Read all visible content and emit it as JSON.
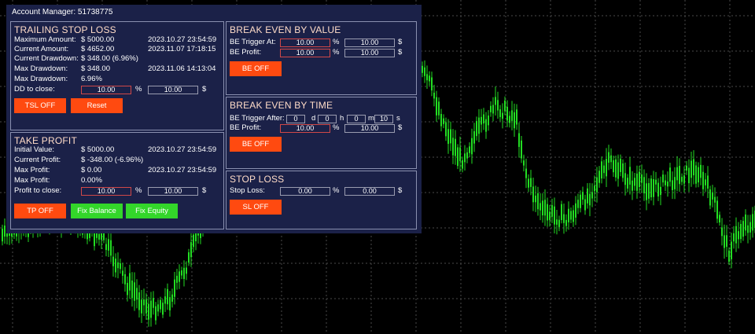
{
  "colors": {
    "panel_bg": "#1b2148",
    "section_border": "#8a90b0",
    "title_color": "#ffdcc8",
    "orange_button": "#ff4a10",
    "green_button": "#33d62a",
    "candle": "#22dd22",
    "grid": "#4a4a4a"
  },
  "panel": {
    "title": "Account Manager: 51738775"
  },
  "trailing_stop_loss": {
    "title": "TRAILING STOP LOSS",
    "rows": [
      {
        "label": "Maximum Amount:",
        "value": "$ 5000.00",
        "time": "2023.10.27 23:54:59"
      },
      {
        "label": "Current Amount:",
        "value": "$ 4652.00",
        "time": "2023.11.07 17:18:15"
      },
      {
        "label": "Current Drawdown:",
        "value": "$ 348.00 (6.96%)",
        "time": ""
      },
      {
        "label": "Max Drawdown:",
        "value": "$ 348.00",
        "time": "2023.11.06 14:13:04"
      },
      {
        "label": "Max Drawdown:",
        "value": "6.96%",
        "time": ""
      }
    ],
    "dd_label": "DD to close:",
    "dd_percent_value": "10.00",
    "percent_unit": "%",
    "dd_dollar_value": "10.00",
    "dollar_unit": "$",
    "tsl_button": "TSL OFF",
    "reset_button": "Reset"
  },
  "take_profit": {
    "title": "TAKE PROFIT",
    "rows": [
      {
        "label": "Initial Value:",
        "value": "$ 5000.00",
        "time": "2023.10.27 23:54:59"
      },
      {
        "label": "Current Profit:",
        "value": "$ -348.00 (-6.96%)",
        "time": ""
      },
      {
        "label": "Max Profit:",
        "value": "$ 0.00",
        "time": "2023.10.27 23:54:59"
      },
      {
        "label": "Max Profit:",
        "value": "0.00%",
        "time": ""
      }
    ],
    "ptc_label": "Profit to close:",
    "ptc_percent_value": "10.00",
    "percent_unit": "%",
    "ptc_dollar_value": "10.00",
    "dollar_unit": "$",
    "tp_button": "TP OFF",
    "fix_balance_button": "Fix Balance",
    "fix_equity_button": "Fix Equity"
  },
  "break_even_value": {
    "title": "BREAK EVEN BY VALUE",
    "trigger_label": "BE Trigger At:",
    "trigger_percent": "10.00",
    "trigger_dollar": "10.00",
    "profit_label": "BE Profit:",
    "profit_percent": "10.00",
    "profit_dollar": "10.00",
    "percent_unit": "%",
    "dollar_unit": "$",
    "button": "BE OFF"
  },
  "break_even_time": {
    "title": "BREAK EVEN BY TIME",
    "trigger_label": "BE Trigger After:",
    "days": "0",
    "days_unit": "d",
    "hours": "0",
    "hours_unit": "h",
    "minutes": "0",
    "minutes_unit": "m",
    "seconds": "10",
    "seconds_unit": "s",
    "profit_label": "BE Profit:",
    "profit_percent": "10.00",
    "profit_dollar": "10.00",
    "percent_unit": "%",
    "dollar_unit": "$",
    "button": "BE OFF"
  },
  "stop_loss": {
    "title": "STOP LOSS",
    "label": "Stop Loss:",
    "percent_value": "0.00",
    "dollar_value": "0.00",
    "percent_unit": "%",
    "dollar_unit": "$",
    "button": "SL OFF"
  }
}
